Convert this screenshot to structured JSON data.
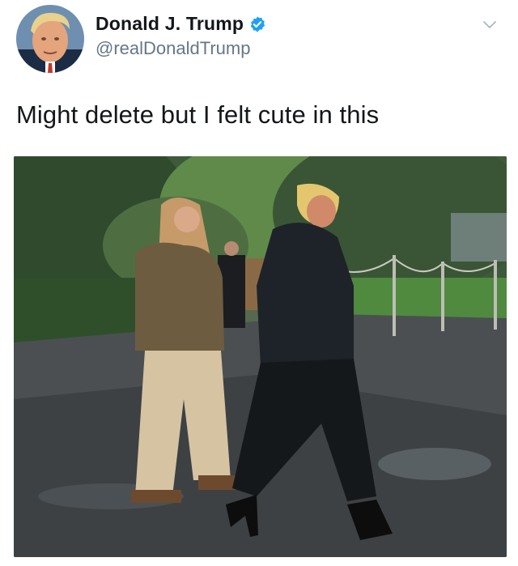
{
  "tweet": {
    "display_name": "Donald J. Trump",
    "handle": "@realDonaldTrump",
    "verified": true,
    "text": "Might delete but I felt cute in this",
    "avatar_icon": "avatar-photo",
    "menu_icon": "chevron-down-icon",
    "verified_color": "#1da1f2"
  },
  "colors": {
    "text_primary": "#14171a",
    "text_secondary": "#657786",
    "background": "#ffffff"
  }
}
